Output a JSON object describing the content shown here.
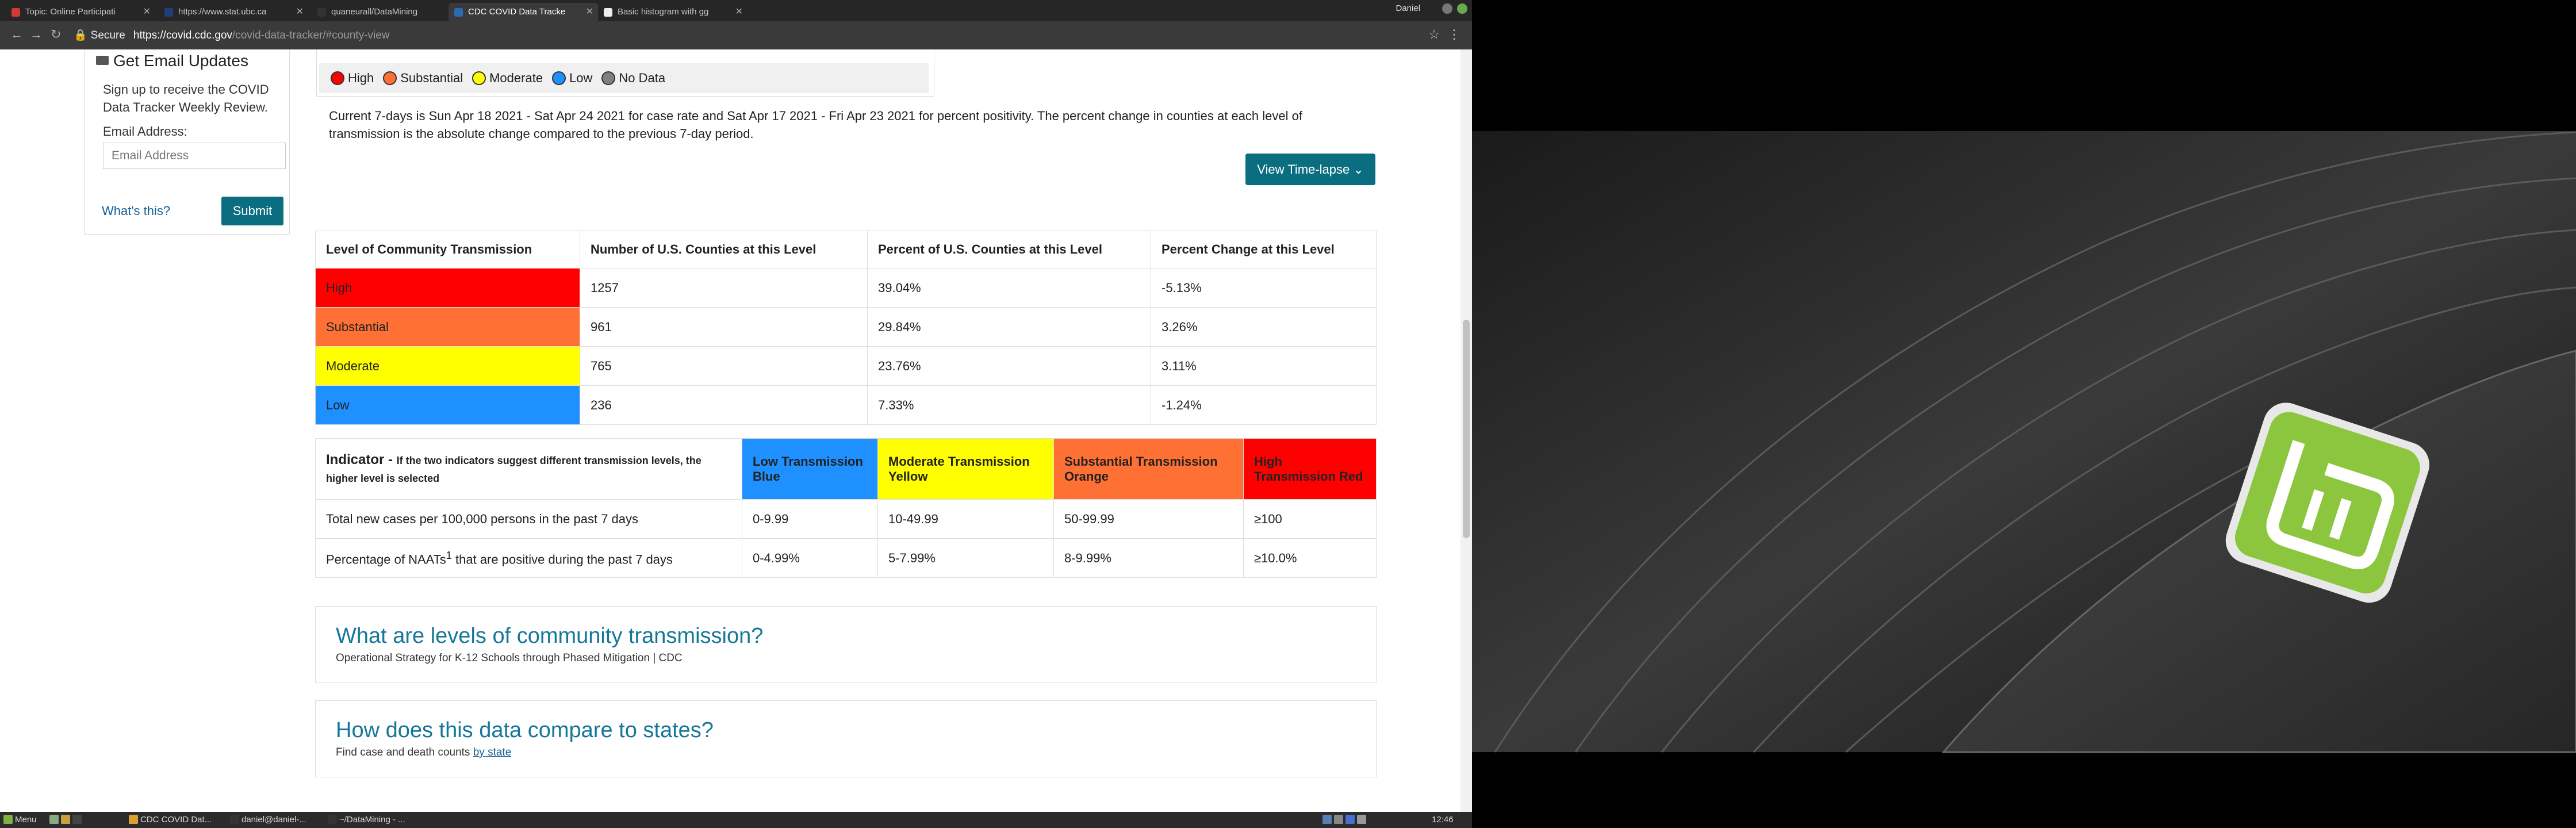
{
  "browser": {
    "tabs": [
      {
        "title": "Topic: Online Participati",
        "active": false,
        "fav_color": "#d23b2f"
      },
      {
        "title": "https://www.stat.ubc.ca",
        "active": false,
        "fav_color": "#1e3f7a"
      },
      {
        "title": "quaneurall/DataMining",
        "active": false,
        "fav_color": "#333333"
      },
      {
        "title": "CDC COVID Data Tracke",
        "active": true,
        "fav_color": "#2c6bb0"
      },
      {
        "title": "Basic histogram with gg",
        "active": false,
        "fav_color": "#eeeeee"
      }
    ],
    "profile_name": "Daniel",
    "url": {
      "secure_label": "Secure",
      "host": "https://covid.cdc.gov",
      "path": "/covid-data-tracker/#county-view"
    }
  },
  "sidebar": {
    "title": "Get Email Updates",
    "description": "Sign up to receive the COVID Data Tracker Weekly Review.",
    "email_label": "Email Address:",
    "email_placeholder": "Email Address",
    "whats_this": "What's this?",
    "submit_label": "Submit"
  },
  "legend": [
    {
      "label": "High",
      "color": "#ff0000"
    },
    {
      "label": "Substantial",
      "color": "#ff7034"
    },
    {
      "label": "Moderate",
      "color": "#ffff00"
    },
    {
      "label": "Low",
      "color": "#1e90ff"
    },
    {
      "label": "No Data",
      "color": "#808080"
    }
  ],
  "current_text": "Current 7-days is Sun Apr 18 2021 - Sat Apr 24 2021 for case rate and Sat Apr 17 2021 - Fri Apr 23 2021 for percent positivity. The percent change in counties at each level of transmission is the absolute change compared to the previous 7-day period.",
  "timelapse_label": "View Time-lapse",
  "level_table": {
    "headers": [
      "Level of Community Transmission",
      "Number of U.S. Counties at this Level",
      "Percent of U.S. Counties at this Level",
      "Percent Change at this Level"
    ],
    "rows": [
      {
        "level": "High",
        "count": "1257",
        "percent": "39.04%",
        "change": "-5.13%",
        "color": "#ff0000"
      },
      {
        "level": "Substantial",
        "count": "961",
        "percent": "29.84%",
        "change": "3.26%",
        "color": "#ff7034"
      },
      {
        "level": "Moderate",
        "count": "765",
        "percent": "23.76%",
        "change": "3.11%",
        "color": "#ffff00"
      },
      {
        "level": "Low",
        "count": "236",
        "percent": "7.33%",
        "change": "-1.24%",
        "color": "#1e90ff"
      }
    ]
  },
  "indicator_table": {
    "header_title": "Indicator - ",
    "header_note": "If the two indicators suggest different transmission levels, the higher level is selected",
    "levels": [
      {
        "label": "Low Transmission Blue",
        "color": "#1e90ff"
      },
      {
        "label": "Moderate Transmission Yellow",
        "color": "#ffff00"
      },
      {
        "label": "Substantial Transmission Orange",
        "color": "#ff7034"
      },
      {
        "label": "High Transmission Red",
        "color": "#ff0000"
      }
    ],
    "rows": [
      {
        "indicator": "Total new cases per 100,000 persons in the past 7 days",
        "values": [
          "0-9.99",
          "10-49.99",
          "50-99.99",
          "≥100"
        ]
      },
      {
        "indicator_prefix": "Percentage of NAATs",
        "indicator_sup": "1",
        "indicator_suffix": " that are positive during the past 7 days",
        "values": [
          "0-4.99%",
          "5-7.99%",
          "8-9.99%",
          "≥10.0%"
        ]
      }
    ]
  },
  "cards": [
    {
      "title": "What are levels of community transmission?",
      "text": "Operational Strategy for K-12 Schools through Phased Mitigation | CDC"
    },
    {
      "title": "How does this data compare to states?",
      "text": "Find case and death counts ",
      "link": "by state"
    }
  ],
  "taskbar": {
    "menu_label": "Menu",
    "windows": [
      "CDC COVID Dat...",
      "daniel@daniel-...",
      "~/DataMining - ..."
    ],
    "clock": "12:46"
  }
}
